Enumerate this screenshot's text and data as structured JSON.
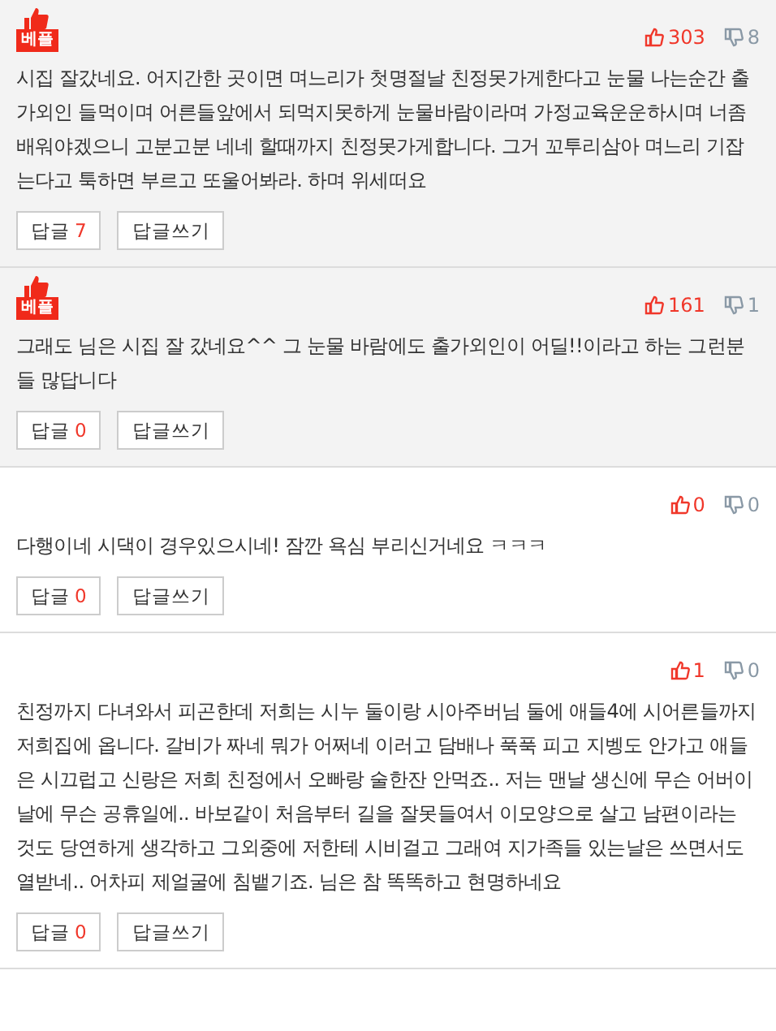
{
  "comments": [
    {
      "best": true,
      "badge": "베플",
      "likes": "303",
      "dislikes": "8",
      "text": "시집 잘갔네요. 어지간한 곳이면 며느리가 첫명절날 친정못가게한다고 눈물 나는순간 출가외인 들먹이며 어른들앞에서 되먹지못하게 눈물바람이라며 가정교육운운하시며 너좀 배워야겠으니 고분고분 네네 할때까지 친정못가게합니다. 그거 꼬투리삼아 며느리 기잡는다고 툭하면 부르고 또울어봐라. 하며 위세떠요",
      "reply_label": "답글",
      "reply_count": "7",
      "write_label": "답글쓰기"
    },
    {
      "best": true,
      "badge": "베플",
      "likes": "161",
      "dislikes": "1",
      "text": "그래도 님은 시집 잘 갔네요^^ 그 눈물 바람에도 출가외인이 어딜!!이라고 하는 그런분들 많답니다",
      "reply_label": "답글",
      "reply_count": "0",
      "write_label": "답글쓰기"
    },
    {
      "best": false,
      "likes": "0",
      "dislikes": "0",
      "text": "다행이네 시댁이 경우있으시네! 잠깐 욕심 부리신거네요 ㅋㅋㅋ",
      "reply_label": "답글",
      "reply_count": "0",
      "write_label": "답글쓰기"
    },
    {
      "best": false,
      "likes": "1",
      "dislikes": "0",
      "text": "친정까지 다녀와서 피곤한데 저희는 시누 둘이랑 시아주버님 둘에 애들4에 시어른들까지 저희집에 옵니다. 갈비가 짜네 뭐가 어쩌네 이러고 담배나 푹푹 피고 지벵도 안가고 애들은 시끄럽고 신랑은 저희 친정에서 오빠랑 술한잔 안먹죠.. 저는 맨날 생신에 무슨 어버이날에 무슨 공휴일에.. 바보같이 처음부터 길을 잘못들여서 이모양으로 살고 남편이라는 것도 당연하게 생각하고 그외중에 저한테 시비걸고 그래여 지가족들 있는날은 쓰면서도 열받네.. 어차피 제얼굴에 침뱉기죠. 님은 참 똑똑하고 현명하네요",
      "reply_label": "답글",
      "reply_count": "0",
      "write_label": "답글쓰기"
    }
  ]
}
